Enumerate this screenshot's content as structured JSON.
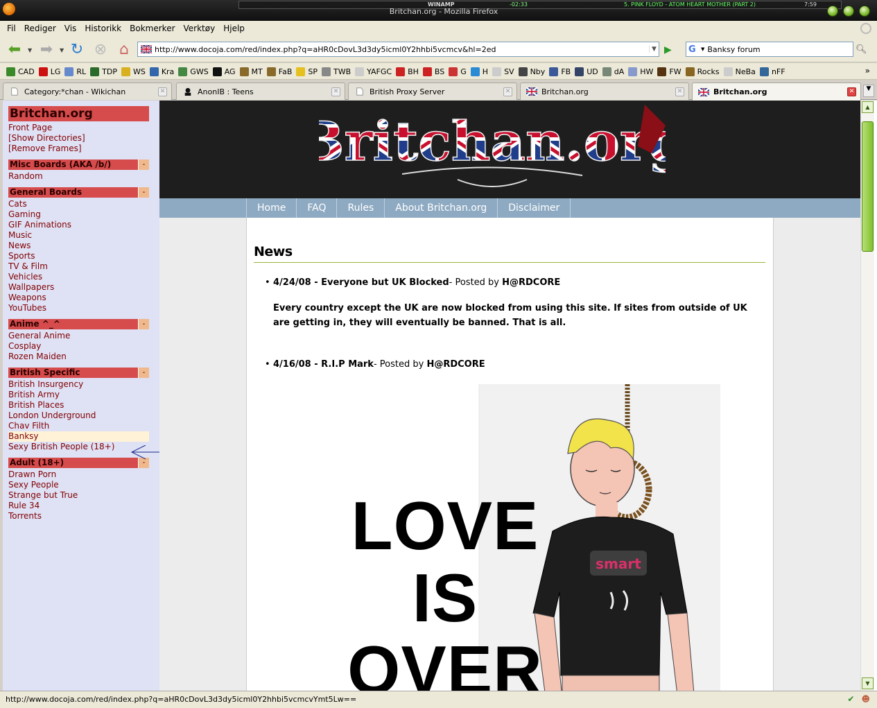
{
  "window": {
    "title": "Britchan.org - Mozilla Firefox",
    "winamp": {
      "label": "WINAMP",
      "time": "-02:33",
      "song": "5. PINK FLOYD - ATOM HEART MOTHER (PART 2)",
      "clock": "7:59"
    }
  },
  "menubar": [
    "Fil",
    "Rediger",
    "Vis",
    "Historikk",
    "Bokmerker",
    "Verktøy",
    "Hjelp"
  ],
  "navbar": {
    "url": "http://www.docoja.com/red/index.php?q=aHR0cDovL3d3dy5icml0Y2hhbi5vcmcv&hl=2ed",
    "search_value": "Banksy forum",
    "search_engine_icon": "G"
  },
  "bookmarks": [
    {
      "label": "CAD",
      "color": "#3a8a2a"
    },
    {
      "label": "LG",
      "color": "#cc1111"
    },
    {
      "label": "RL",
      "color": "#6688cc"
    },
    {
      "label": "TDP",
      "color": "#2a6a2a"
    },
    {
      "label": "WS",
      "color": "#d8b020"
    },
    {
      "label": "Kra",
      "color": "#3366aa"
    },
    {
      "label": "GWS",
      "color": "#448844"
    },
    {
      "label": "AG",
      "color": "#111111"
    },
    {
      "label": "MT",
      "color": "#8a6a2a"
    },
    {
      "label": "FaB",
      "color": "#8a6a2a"
    },
    {
      "label": "SP",
      "color": "#e6c020"
    },
    {
      "label": "TWB",
      "color": "#888888"
    },
    {
      "label": "YAFGC",
      "color": "#cccccc"
    },
    {
      "label": "BH",
      "color": "#cc2222"
    },
    {
      "label": "BS",
      "color": "#cc2222"
    },
    {
      "label": "G",
      "color": "#cc3333"
    },
    {
      "label": "H",
      "color": "#2a8ad4"
    },
    {
      "label": "SV",
      "color": "#cccccc"
    },
    {
      "label": "Nby",
      "color": "#444444"
    },
    {
      "label": "FB",
      "color": "#3b5998"
    },
    {
      "label": "UD",
      "color": "#334466"
    },
    {
      "label": "dA",
      "color": "#778877"
    },
    {
      "label": "HW",
      "color": "#8899cc"
    },
    {
      "label": "FW",
      "color": "#553311"
    },
    {
      "label": "Rocks",
      "color": "#886622"
    },
    {
      "label": "NeBa",
      "color": "#cccccc"
    },
    {
      "label": "nFF",
      "color": "#336699"
    }
  ],
  "tabs": [
    {
      "label": "Category:*chan - Wikichan",
      "icon": "page-icon"
    },
    {
      "label": "AnonIB : Teens",
      "icon": "anonib-icon"
    },
    {
      "label": "British Proxy Server",
      "icon": "page-icon"
    },
    {
      "label": "Britchan.org",
      "icon": "uk-flag-icon"
    },
    {
      "label": "Britchan.org",
      "icon": "uk-flag-icon"
    }
  ],
  "sidebar": {
    "title": "Britchan.org",
    "top_links": [
      "Front Page",
      "[Show Directories]",
      "[Remove Frames]"
    ],
    "sections": [
      {
        "title": "Misc Boards (AKA /b/)",
        "toggle": "-",
        "links": [
          "Random"
        ]
      },
      {
        "title": "General Boards",
        "toggle": "-",
        "links": [
          "Cats",
          "Gaming",
          "GIF Animations",
          "Music",
          "News",
          "Sports",
          "TV & Film",
          "Vehicles",
          "Wallpapers",
          "Weapons",
          "YouTubes"
        ]
      },
      {
        "title": "Anime ^_^",
        "toggle": "-",
        "links": [
          "General Anime",
          "Cosplay",
          "Rozen Maiden"
        ]
      },
      {
        "title": "British Specific",
        "toggle": "-",
        "links": [
          "British Insurgency",
          "British Army",
          "British Places",
          "London Underground",
          "Chav Filth",
          "Banksy",
          "Sexy British People (18+)"
        ]
      },
      {
        "title": "Adult (18+)",
        "toggle": "-",
        "links": [
          "Drawn Porn",
          "Sexy People",
          "Strange but True",
          "Rule 34",
          "Torrents"
        ]
      }
    ],
    "highlighted_link": "Banksy"
  },
  "site": {
    "banner_text": "Britchan.org",
    "topnav": [
      "Home",
      "FAQ",
      "Rules",
      "About Britchan.org",
      "Disclaimer"
    ],
    "news_heading": "News",
    "news": [
      {
        "title": "4/24/08 - Everyone but UK Blocked",
        "posted_by_prefix": "- Posted by ",
        "poster": "H@RDCORE",
        "body": "Every country except the UK are now blocked from using this site. If sites from outside of UK are getting in, they will eventually be banned. That is all."
      },
      {
        "title": "4/16/08 - R.I.P Mark",
        "posted_by_prefix": "- Posted by ",
        "poster": "H@RDCORE",
        "body": ""
      }
    ],
    "image_text": [
      "LOVE",
      "IS",
      "OVER"
    ],
    "shirt_text": "smart"
  },
  "statusbar": {
    "text": "http://www.docoja.com/red/index.php?q=aHR0cDovL3d3dy5icml0Y2hhbi5vcmcvYmt5Lw=="
  },
  "colors": {
    "sidebar_bg": "#dfe1f5",
    "section_header": "#d64b4b",
    "link_color": "#800000",
    "topnav_bg": "#8eaac2",
    "accent_green": "#7fbf2a"
  }
}
